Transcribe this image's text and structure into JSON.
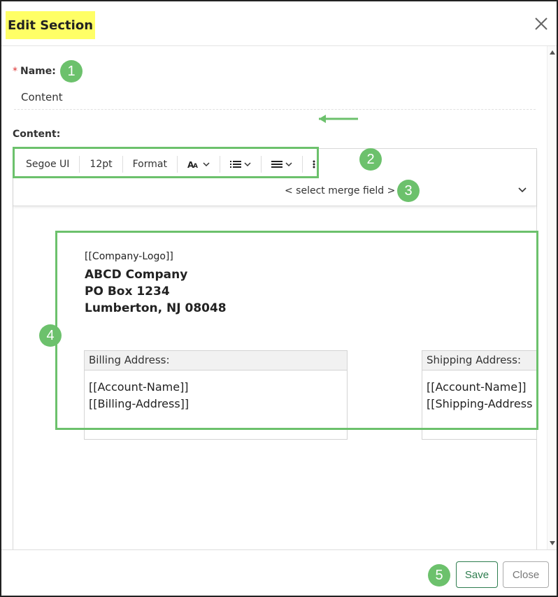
{
  "dialog": {
    "title": "Edit Section"
  },
  "badges": {
    "b1": "1",
    "b2": "2",
    "b3": "3",
    "b4": "4",
    "b5": "5"
  },
  "form": {
    "name_label": "Name:",
    "required_mark": "*",
    "name_value": "Content",
    "content_label": "Content:"
  },
  "toolbar": {
    "font_family": "Segoe UI",
    "font_size": "12pt",
    "format_label": "Format",
    "text_size_icon": "font-size-icon",
    "list_icon": "bullet-list-icon",
    "align_icon": "align-icon",
    "more_icon": "more-vertical-icon",
    "merge_field": "< select merge field >"
  },
  "document": {
    "logo_placeholder": "[[Company-Logo]]",
    "company_lines": [
      "ABCD Company",
      "PO Box 1234",
      "Lumberton, NJ 08048"
    ],
    "billing": {
      "heading": "Billing Address:",
      "lines": [
        "[[Account-Name]]",
        "[[Billing-Address]]"
      ]
    },
    "shipping": {
      "heading": "Shipping Address:",
      "lines": [
        "[[Account-Name]]",
        "[[Shipping-Address"
      ]
    }
  },
  "footer": {
    "save_label": "Save",
    "close_label": "Close"
  },
  "colors": {
    "highlight": "#ffff66",
    "annotation_green": "#6cc16c",
    "save_green": "#2e7d4f"
  }
}
